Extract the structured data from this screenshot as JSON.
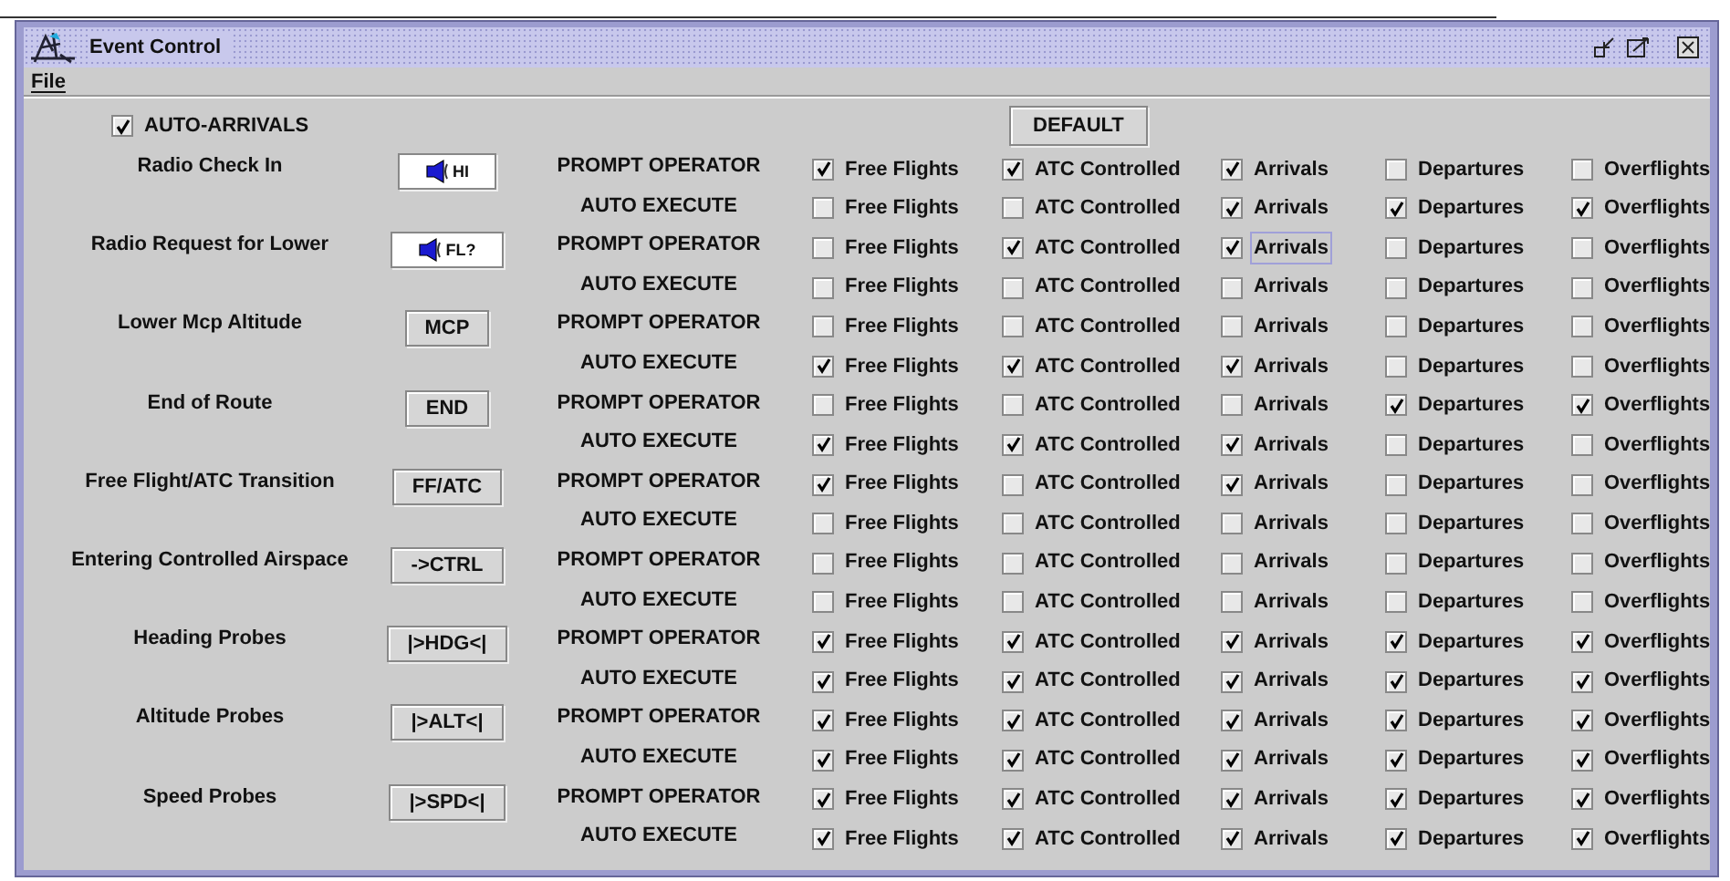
{
  "window": {
    "title": "Event Control"
  },
  "menu": [
    "File"
  ],
  "auto_arrivals": {
    "label": "AUTO-ARRIVALS",
    "checked": true
  },
  "default_button": "DEFAULT",
  "events": [
    {
      "label": "Radio Check In",
      "button": {
        "kind": "speaker",
        "text": "HI"
      },
      "modes": [
        {
          "label": "PROMPT OPERATOR",
          "options": [
            {
              "label": "Free Flights",
              "checked": true
            },
            {
              "label": "ATC Controlled",
              "checked": true
            },
            {
              "label": "Arrivals",
              "checked": true
            },
            {
              "label": "Departures",
              "checked": false
            },
            {
              "label": "Overflights",
              "checked": false
            }
          ]
        },
        {
          "label": "AUTO EXECUTE",
          "options": [
            {
              "label": "Free Flights",
              "checked": false
            },
            {
              "label": "ATC Controlled",
              "checked": false
            },
            {
              "label": "Arrivals",
              "checked": true
            },
            {
              "label": "Departures",
              "checked": true
            },
            {
              "label": "Overflights",
              "checked": true
            }
          ]
        }
      ]
    },
    {
      "label": "Radio Request for Lower",
      "button": {
        "kind": "speaker",
        "text": "FL?"
      },
      "modes": [
        {
          "label": "PROMPT OPERATOR",
          "options": [
            {
              "label": "Free Flights",
              "checked": false
            },
            {
              "label": "ATC Controlled",
              "checked": true
            },
            {
              "label": "Arrivals",
              "checked": true,
              "focused": true
            },
            {
              "label": "Departures",
              "checked": false
            },
            {
              "label": "Overflights",
              "checked": false
            }
          ]
        },
        {
          "label": "AUTO EXECUTE",
          "options": [
            {
              "label": "Free Flights",
              "checked": false
            },
            {
              "label": "ATC Controlled",
              "checked": false
            },
            {
              "label": "Arrivals",
              "checked": false
            },
            {
              "label": "Departures",
              "checked": false
            },
            {
              "label": "Overflights",
              "checked": false
            }
          ]
        }
      ]
    },
    {
      "label": "Lower Mcp Altitude",
      "button": {
        "kind": "text",
        "text": "MCP"
      },
      "modes": [
        {
          "label": "PROMPT OPERATOR",
          "options": [
            {
              "label": "Free Flights",
              "checked": false
            },
            {
              "label": "ATC Controlled",
              "checked": false
            },
            {
              "label": "Arrivals",
              "checked": false
            },
            {
              "label": "Departures",
              "checked": false
            },
            {
              "label": "Overflights",
              "checked": false
            }
          ]
        },
        {
          "label": "AUTO EXECUTE",
          "options": [
            {
              "label": "Free Flights",
              "checked": true
            },
            {
              "label": "ATC Controlled",
              "checked": true
            },
            {
              "label": "Arrivals",
              "checked": true
            },
            {
              "label": "Departures",
              "checked": false
            },
            {
              "label": "Overflights",
              "checked": false
            }
          ]
        }
      ]
    },
    {
      "label": "End of Route",
      "button": {
        "kind": "text",
        "text": "END"
      },
      "modes": [
        {
          "label": "PROMPT OPERATOR",
          "options": [
            {
              "label": "Free Flights",
              "checked": false
            },
            {
              "label": "ATC Controlled",
              "checked": false
            },
            {
              "label": "Arrivals",
              "checked": false
            },
            {
              "label": "Departures",
              "checked": true
            },
            {
              "label": "Overflights",
              "checked": true
            }
          ]
        },
        {
          "label": "AUTO EXECUTE",
          "options": [
            {
              "label": "Free Flights",
              "checked": true
            },
            {
              "label": "ATC Controlled",
              "checked": true
            },
            {
              "label": "Arrivals",
              "checked": true
            },
            {
              "label": "Departures",
              "checked": false
            },
            {
              "label": "Overflights",
              "checked": false
            }
          ]
        }
      ]
    },
    {
      "label": "Free Flight/ATC Transition",
      "button": {
        "kind": "text",
        "text": "FF/ATC"
      },
      "modes": [
        {
          "label": "PROMPT OPERATOR",
          "options": [
            {
              "label": "Free Flights",
              "checked": true
            },
            {
              "label": "ATC Controlled",
              "checked": false
            },
            {
              "label": "Arrivals",
              "checked": true
            },
            {
              "label": "Departures",
              "checked": false
            },
            {
              "label": "Overflights",
              "checked": false
            }
          ]
        },
        {
          "label": "AUTO EXECUTE",
          "options": [
            {
              "label": "Free Flights",
              "checked": false
            },
            {
              "label": "ATC Controlled",
              "checked": false
            },
            {
              "label": "Arrivals",
              "checked": false
            },
            {
              "label": "Departures",
              "checked": false
            },
            {
              "label": "Overflights",
              "checked": false
            }
          ]
        }
      ]
    },
    {
      "label": "Entering Controlled Airspace",
      "button": {
        "kind": "text",
        "text": "->CTRL"
      },
      "modes": [
        {
          "label": "PROMPT OPERATOR",
          "options": [
            {
              "label": "Free Flights",
              "checked": false
            },
            {
              "label": "ATC Controlled",
              "checked": false
            },
            {
              "label": "Arrivals",
              "checked": false
            },
            {
              "label": "Departures",
              "checked": false
            },
            {
              "label": "Overflights",
              "checked": false
            }
          ]
        },
        {
          "label": "AUTO EXECUTE",
          "options": [
            {
              "label": "Free Flights",
              "checked": false
            },
            {
              "label": "ATC Controlled",
              "checked": false
            },
            {
              "label": "Arrivals",
              "checked": false
            },
            {
              "label": "Departures",
              "checked": false
            },
            {
              "label": "Overflights",
              "checked": false
            }
          ]
        }
      ]
    },
    {
      "label": "Heading Probes",
      "button": {
        "kind": "text",
        "text": "|>HDG<|"
      },
      "modes": [
        {
          "label": "PROMPT OPERATOR",
          "options": [
            {
              "label": "Free Flights",
              "checked": true
            },
            {
              "label": "ATC Controlled",
              "checked": true
            },
            {
              "label": "Arrivals",
              "checked": true
            },
            {
              "label": "Departures",
              "checked": true
            },
            {
              "label": "Overflights",
              "checked": true
            }
          ]
        },
        {
          "label": "AUTO EXECUTE",
          "options": [
            {
              "label": "Free Flights",
              "checked": true
            },
            {
              "label": "ATC Controlled",
              "checked": true
            },
            {
              "label": "Arrivals",
              "checked": true
            },
            {
              "label": "Departures",
              "checked": true
            },
            {
              "label": "Overflights",
              "checked": true
            }
          ]
        }
      ]
    },
    {
      "label": "Altitude Probes",
      "button": {
        "kind": "text",
        "text": "|>ALT<|"
      },
      "modes": [
        {
          "label": "PROMPT OPERATOR",
          "options": [
            {
              "label": "Free Flights",
              "checked": true
            },
            {
              "label": "ATC Controlled",
              "checked": true
            },
            {
              "label": "Arrivals",
              "checked": true
            },
            {
              "label": "Departures",
              "checked": true
            },
            {
              "label": "Overflights",
              "checked": true
            }
          ]
        },
        {
          "label": "AUTO EXECUTE",
          "options": [
            {
              "label": "Free Flights",
              "checked": true
            },
            {
              "label": "ATC Controlled",
              "checked": true
            },
            {
              "label": "Arrivals",
              "checked": true
            },
            {
              "label": "Departures",
              "checked": true
            },
            {
              "label": "Overflights",
              "checked": true
            }
          ]
        }
      ]
    },
    {
      "label": "Speed Probes",
      "button": {
        "kind": "text",
        "text": "|>SPD<|"
      },
      "modes": [
        {
          "label": "PROMPT OPERATOR",
          "options": [
            {
              "label": "Free Flights",
              "checked": true
            },
            {
              "label": "ATC Controlled",
              "checked": true
            },
            {
              "label": "Arrivals",
              "checked": true
            },
            {
              "label": "Departures",
              "checked": true
            },
            {
              "label": "Overflights",
              "checked": true
            }
          ]
        },
        {
          "label": "AUTO EXECUTE",
          "options": [
            {
              "label": "Free Flights",
              "checked": true
            },
            {
              "label": "ATC Controlled",
              "checked": true
            },
            {
              "label": "Arrivals",
              "checked": true
            },
            {
              "label": "Departures",
              "checked": true
            },
            {
              "label": "Overflights",
              "checked": true
            }
          ]
        }
      ]
    }
  ]
}
